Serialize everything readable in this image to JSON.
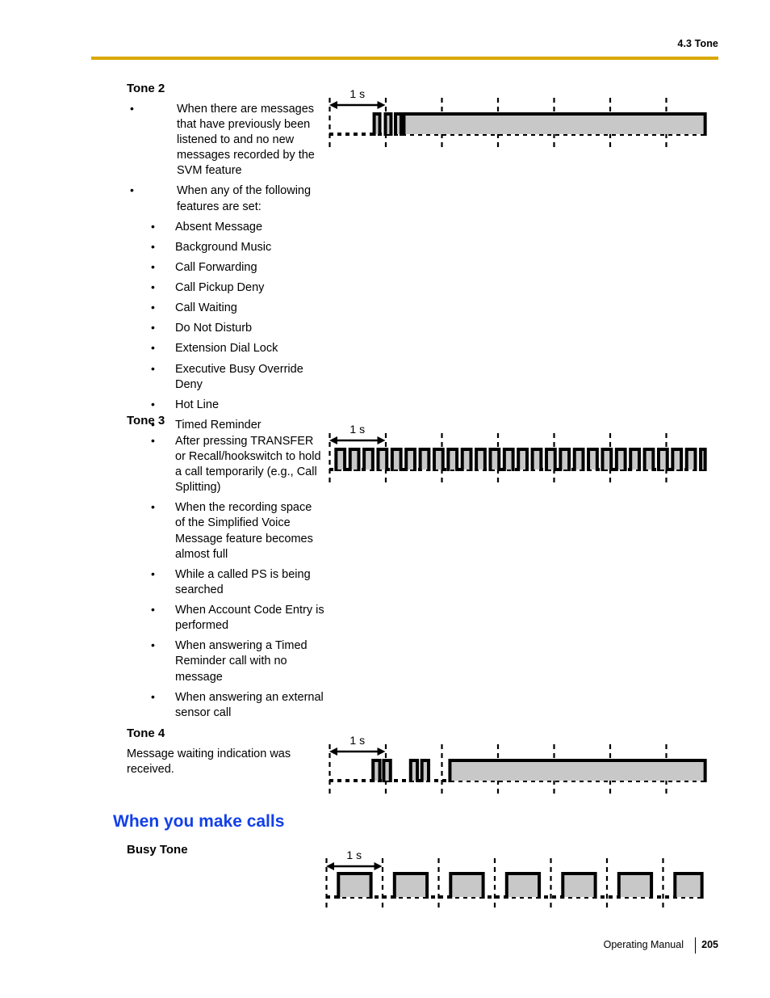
{
  "header": {
    "section_title": "4.3 Tone",
    "rule_color": "#d9a800"
  },
  "footer": {
    "manual_label": "Operating Manual",
    "page_number": "205"
  },
  "colors": {
    "heading_blue": "#1240e8",
    "wave_fill_gray": "#c8c8c8",
    "wave_stroke": "#000000"
  },
  "sections": {
    "tone2": {
      "heading": "Tone 2",
      "bullets": [
        "When there are messages that have previously been listened to and no new messages recorded by the SVM feature",
        "When any of the following features are set:"
      ],
      "subbullets": [
        "Absent Message",
        "Background Music",
        "Call Forwarding",
        "Call Pickup Deny",
        "Call Waiting",
        "Do Not Disturb",
        "Extension Dial Lock",
        "Executive Busy Override Deny",
        "Hot Line",
        "Timed Reminder"
      ]
    },
    "tone3": {
      "heading": "Tone 3",
      "bullets": [
        "After pressing TRANSFER or Recall/hookswitch to hold a call temporarily (e.g., Call Splitting)",
        "When the recording space of the Simplified Voice Message feature becomes almost full",
        "While a called PS is being searched",
        "When Account Code Entry is performed",
        "When answering a Timed Reminder call with no message",
        "When answering an external sensor call"
      ]
    },
    "tone4": {
      "heading": "Tone 4",
      "body": "Message waiting indication was received."
    },
    "make_calls": {
      "heading": "When you make calls"
    },
    "busy_tone": {
      "heading": "Busy Tone"
    }
  },
  "diagrams": {
    "scale_label": "1 s",
    "tone2": {
      "name": "tone-2-waveform",
      "description": "Three short pulses then continuous tone",
      "pulses": [
        {
          "start": 0.8,
          "end": 0.9
        },
        {
          "start": 1.0,
          "end": 1.1
        },
        {
          "start": 1.18,
          "end": 1.28
        },
        {
          "start": 1.33,
          "end": 6.7
        }
      ],
      "gridlines": [
        0,
        1,
        2,
        3,
        4,
        5,
        6
      ],
      "span_seconds": 6.7
    },
    "tone3": {
      "name": "tone-3-waveform",
      "description": "Continuous rapid pulse train",
      "pulse_period": 0.25,
      "pulse_duty": 0.62,
      "pulse_count": 27,
      "gridlines": [
        0,
        1,
        2,
        3,
        4,
        5,
        6
      ],
      "span_seconds": 6.7
    },
    "tone4": {
      "name": "tone-4-waveform",
      "description": "Two pulses, gap, two pulses, gap, then continuous tone",
      "pulses": [
        {
          "start": 0.78,
          "end": 0.9
        },
        {
          "start": 0.97,
          "end": 1.09
        },
        {
          "start": 1.45,
          "end": 1.57
        },
        {
          "start": 1.65,
          "end": 1.77
        },
        {
          "start": 2.15,
          "end": 6.7
        }
      ],
      "gridlines": [
        0,
        1,
        2,
        3,
        4,
        5,
        6
      ],
      "span_seconds": 6.7
    },
    "busy_tone": {
      "name": "busy-tone-waveform",
      "description": "Repeating square wave, half second on and half second off",
      "pulses": [
        {
          "start": 0.22,
          "end": 0.8
        },
        {
          "start": 1.22,
          "end": 1.8
        },
        {
          "start": 2.22,
          "end": 2.8
        },
        {
          "start": 3.22,
          "end": 3.8
        },
        {
          "start": 4.22,
          "end": 4.8
        },
        {
          "start": 5.22,
          "end": 5.8
        },
        {
          "start": 6.22,
          "end": 6.7
        }
      ],
      "gridlines": [
        0,
        1,
        2,
        3,
        4,
        5,
        6
      ],
      "span_seconds": 6.7
    }
  }
}
